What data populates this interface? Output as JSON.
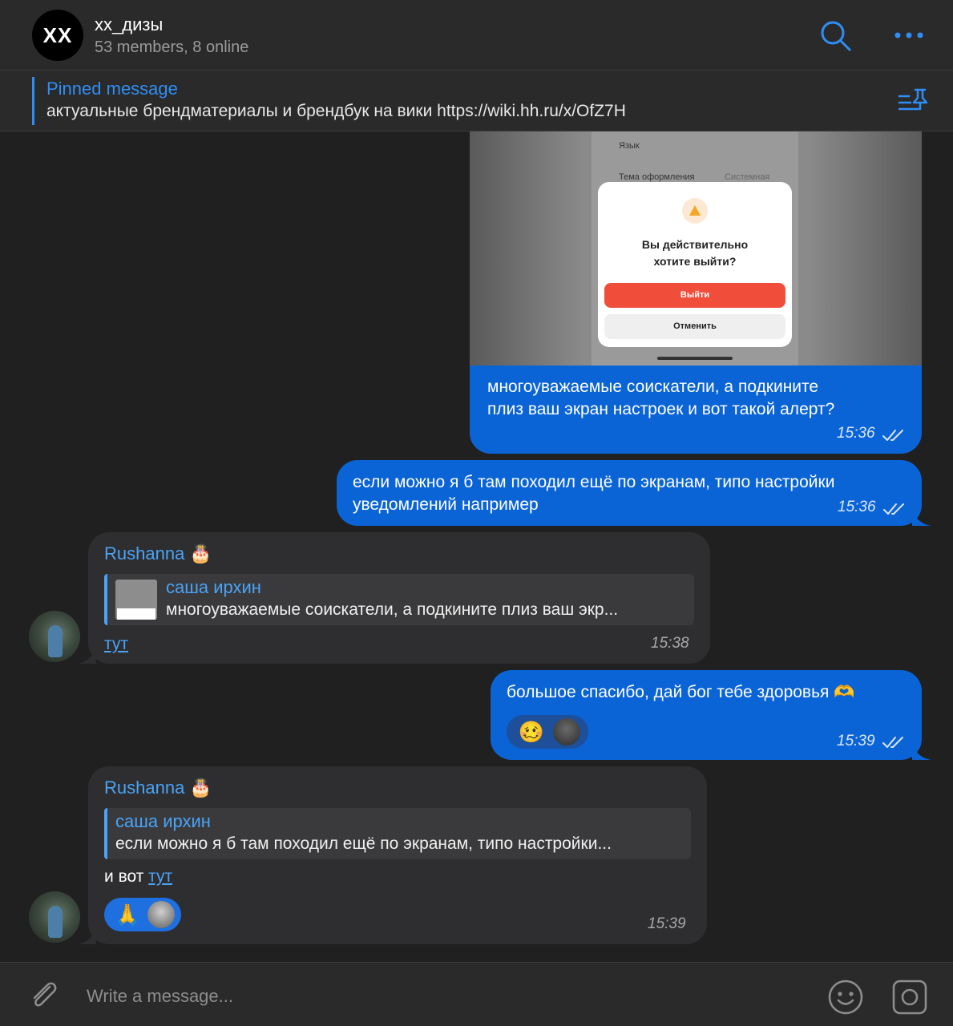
{
  "header": {
    "avatar_initials": "XX",
    "title": "xx_дизы",
    "subtitle": "53 members, 8 online",
    "search_icon": "search-icon",
    "more_icon": "more-icon"
  },
  "pinned": {
    "title": "Pinned message",
    "text": "актуальные брендматериалы и брендбук на вики https://wiki.hh.ru/x/OfZ7H",
    "icon": "pinned-list-icon"
  },
  "shared_screenshot": {
    "row1": "Язык",
    "row2": "Тема оформления",
    "row2_value": "Системная",
    "dialog_title_line1": "Вы действительно",
    "dialog_title_line2": "хотите выйти?",
    "confirm_label": "Выйти",
    "cancel_label": "Отменить"
  },
  "messages": [
    {
      "direction": "out",
      "line1": "многоуважаемые соискатели, а подкините",
      "line2": "плиз ваш экран настроек и вот такой алерт?",
      "time": "15:36"
    },
    {
      "direction": "out",
      "line1": "если можно я б там походил ещё по экранам, типо настройки",
      "line2": "уведомлений например",
      "time": "15:36"
    },
    {
      "direction": "in",
      "sender": "Rushanna",
      "sender_emoji": "🎂",
      "reply_name": "саша ирхин",
      "reply_text": "многоуважаемые соискатели, а подкините плиз ваш экр...",
      "link_text": "тут",
      "time": "15:38"
    },
    {
      "direction": "out",
      "text": "большое спасибо, дай бог тебе здоровья",
      "text_emoji": "🫶",
      "reaction_emoji": "🥴",
      "time": "15:39"
    },
    {
      "direction": "in",
      "sender": "Rushanna",
      "sender_emoji": "🎂",
      "reply_name": "саша ирхин",
      "reply_text": "если можно я б там походил ещё по экранам, типо настройки...",
      "prefix": "и вот ",
      "link_text": "тут",
      "reaction_emoji": "🙏",
      "time": "15:39"
    }
  ],
  "composer": {
    "placeholder": "Write a message...",
    "attach_icon": "paperclip-icon",
    "emoji_icon": "emoji-icon",
    "camera_icon": "camera-icon"
  },
  "colors": {
    "accent": "#2f8ef5",
    "outgoing_bubble": "#0a64d6",
    "incoming_bubble": "#2e2e30",
    "background": "#202020"
  }
}
